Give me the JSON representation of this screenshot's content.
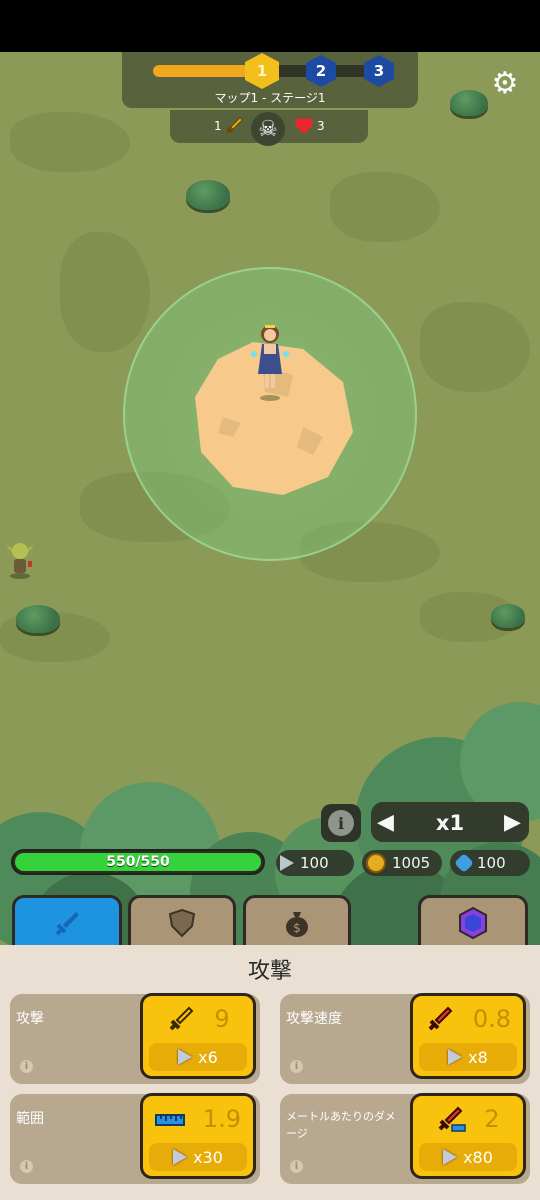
{
  "hud": {
    "stages": [
      "1",
      "2",
      "3"
    ],
    "stage_label": "マップ1 - ステージ1",
    "progress": 0.4,
    "sword_count": "1",
    "heart_count": "3"
  },
  "player": {
    "hp_text": "550/550",
    "hp_fraction": 1.0
  },
  "resources": {
    "shards": "100",
    "coins": "1005",
    "gems": "100"
  },
  "speed": {
    "value": "x1"
  },
  "tabs": [
    {
      "icon": "sword-icon",
      "active": true
    },
    {
      "icon": "shield-icon",
      "active": false
    },
    {
      "icon": "money-bag-icon",
      "active": false
    },
    {
      "icon": "purple-gem-icon",
      "active": false
    }
  ],
  "panel": {
    "title": "攻撃",
    "upgrades": [
      {
        "label": "攻撃",
        "value": "9",
        "cost": "x6",
        "icon": "sword-icon"
      },
      {
        "label": "攻撃速度",
        "value": "0.8",
        "cost": "x8",
        "icon": "red-sword-icon"
      },
      {
        "label": "範囲",
        "value": "1.9",
        "cost": "x30",
        "icon": "ruler-icon"
      },
      {
        "label": "メートルあたりのダメージ",
        "value": "2",
        "cost": "x80",
        "icon": "sword-ruler-icon"
      }
    ]
  },
  "colors": {
    "accent_yellow": "#f8c20d",
    "hp_green": "#36d23b",
    "tab_active": "#1e93e0",
    "grass": "#8c9a58"
  }
}
